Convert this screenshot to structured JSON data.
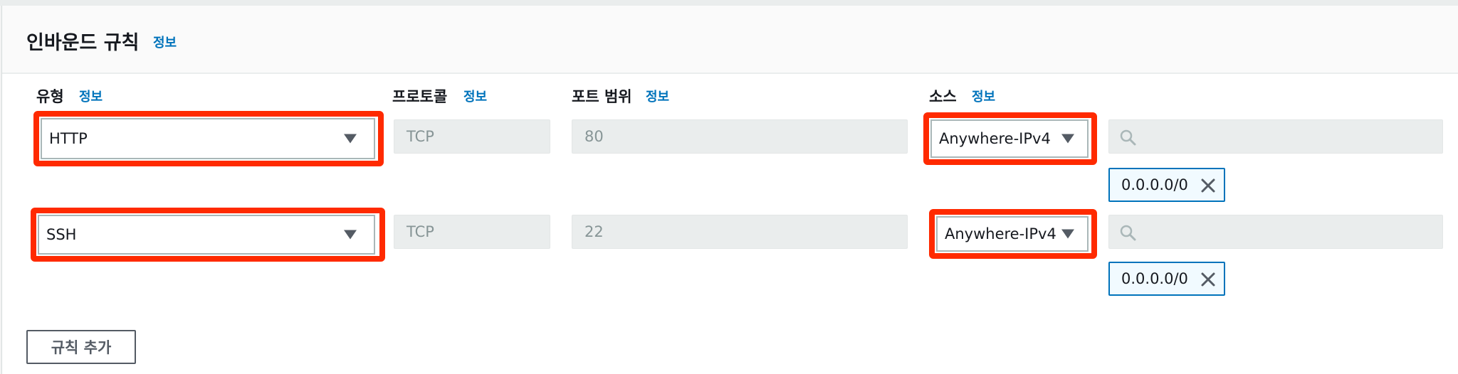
{
  "section": {
    "title": "인바운드 규칙",
    "info": "정보"
  },
  "columns": {
    "type": {
      "label": "유형",
      "info": "정보"
    },
    "protocol": {
      "label": "프로토콜",
      "info": "정보"
    },
    "port_range": {
      "label": "포트 범위",
      "info": "정보"
    },
    "source": {
      "label": "소스",
      "info": "정보"
    }
  },
  "rules": [
    {
      "type": "HTTP",
      "protocol": "TCP",
      "port_range": "80",
      "source": "Anywhere-IPv4",
      "cidr_search_placeholder": "",
      "cidr_token": "0.0.0.0/0"
    },
    {
      "type": "SSH",
      "protocol": "TCP",
      "port_range": "22",
      "source": "Anywhere-IPv4",
      "cidr_search_placeholder": "",
      "cidr_token": "0.0.0.0/0"
    }
  ],
  "add_rule_button": "규칙 추가",
  "colors": {
    "highlight": "#ff2a00",
    "link": "#0073bb",
    "token_border": "#0073bb",
    "disabled_bg": "#eaeded"
  },
  "icons": [
    "search-icon",
    "close-icon",
    "caret-down-icon"
  ]
}
